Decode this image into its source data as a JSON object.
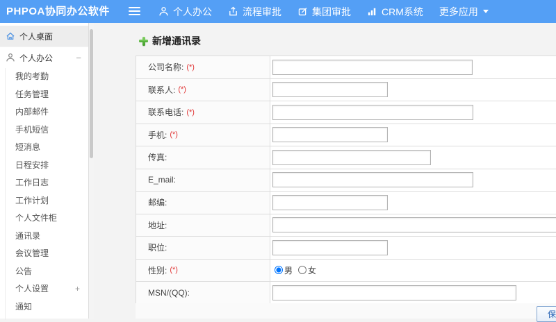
{
  "topbar": {
    "title": "PHPOA协同办公软件",
    "nav": [
      {
        "label": "个人办公",
        "icon": "user-icon"
      },
      {
        "label": "流程审批",
        "icon": "upload-icon"
      },
      {
        "label": "集团审批",
        "icon": "edit-icon"
      },
      {
        "label": "CRM系统",
        "icon": "bar-chart-icon"
      },
      {
        "label": "更多应用",
        "icon": "caret-down-icon"
      }
    ]
  },
  "sidebar": {
    "desktop_label": "个人桌面",
    "office_label": "个人办公",
    "collapse_indicator": "−",
    "expand_indicator": "+",
    "items": [
      "我的考勤",
      "任务管理",
      "内部邮件",
      "手机短信",
      "短消息",
      "日程安排",
      "工作日志",
      "工作计划",
      "个人文件柜",
      "通讯录",
      "会议管理",
      "公告",
      "个人设置",
      "通知"
    ]
  },
  "main": {
    "page_title": "新增通讯录",
    "save_label": "保存",
    "form": {
      "rows": [
        {
          "label": "公司名称:",
          "required": "(*)"
        },
        {
          "label": "联系人:",
          "required": "(*)"
        },
        {
          "label": "联系电话:",
          "required": "(*)"
        },
        {
          "label": "手机:",
          "required": "(*)"
        },
        {
          "label": "传真:"
        },
        {
          "label": "E_mail:"
        },
        {
          "label": "邮编:"
        },
        {
          "label": "地址:"
        },
        {
          "label": "职位:"
        },
        {
          "label": "性别:",
          "required": "(*)"
        },
        {
          "label": "MSN/(QQ):"
        }
      ],
      "gender_male": "男",
      "gender_female": "女",
      "gender_selected": "男"
    }
  },
  "colors": {
    "topbar_blue": "#549ff5",
    "accent_green": "#4aa52e",
    "required_red": "#e03434",
    "button_blue": "#2763b4"
  }
}
